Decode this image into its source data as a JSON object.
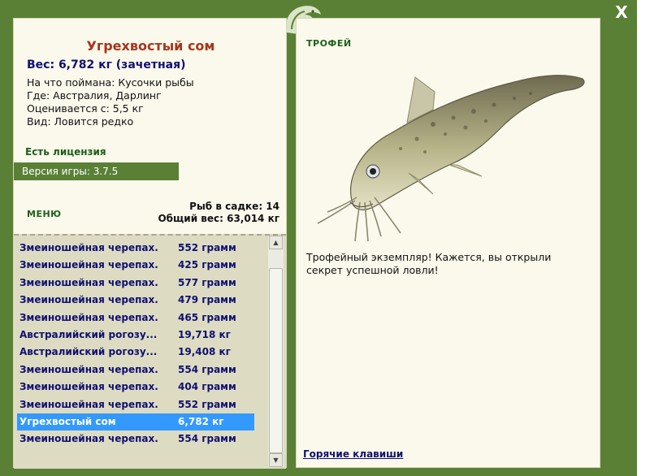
{
  "window": {
    "close_label": "X"
  },
  "fish": {
    "name": "Угрехвостый сом",
    "weight_line": "Вес: 6,782 кг (зачетная)",
    "caught_on": "На что поймана: Кусочки рыбы",
    "location": "Где: Австралия, Дарлинг",
    "valued_from": "Оценивается с: 5,5 кг",
    "species_rarity": "Вид: Ловится редко"
  },
  "license": "Есть лицензия",
  "game_version": "Версия игры: 3.7.5",
  "menu_label": "МЕНЮ",
  "stats": {
    "fish_in_keepnet": "Рыб в садке: 14",
    "total_weight": "Общий вес: 63,014 кг"
  },
  "catch_list": [
    {
      "name": "Змеиношейная черепах...",
      "weight": "552 грамм"
    },
    {
      "name": "Змеиношейная черепах...",
      "weight": "425 грамм"
    },
    {
      "name": "Змеиношейная черепах...",
      "weight": "577 грамм"
    },
    {
      "name": "Змеиношейная черепах...",
      "weight": "479 грамм"
    },
    {
      "name": "Змеиношейная черепах...",
      "weight": "465 грамм"
    },
    {
      "name": "Австралийский рогозу...",
      "weight": "19,718 кг"
    },
    {
      "name": "Австралийский рогозу...",
      "weight": "19,408 кг"
    },
    {
      "name": "Змеиношейная черепах...",
      "weight": "554 грамм"
    },
    {
      "name": "Змеиношейная черепах...",
      "weight": "404 грамм"
    },
    {
      "name": "Змеиношейная черепах...",
      "weight": "552 грамм"
    },
    {
      "name": "Угрехвостый сом",
      "weight": "6,782 кг",
      "selected": true
    },
    {
      "name": "Змеиношейная черепах...",
      "weight": "554 грамм"
    }
  ],
  "trophy": {
    "label": "ТРОФЕЙ",
    "description": "Трофейный экземпляр! Кажется, вы открыли секрет успешной ловли!"
  },
  "hotkeys_label": "Горячие клавиши",
  "colors": {
    "frame_green": "#5a8036",
    "panel_bg": "#fbf9ec",
    "title_red": "#a6361c",
    "text_navy": "#101070",
    "selection_blue": "#3399ff"
  }
}
